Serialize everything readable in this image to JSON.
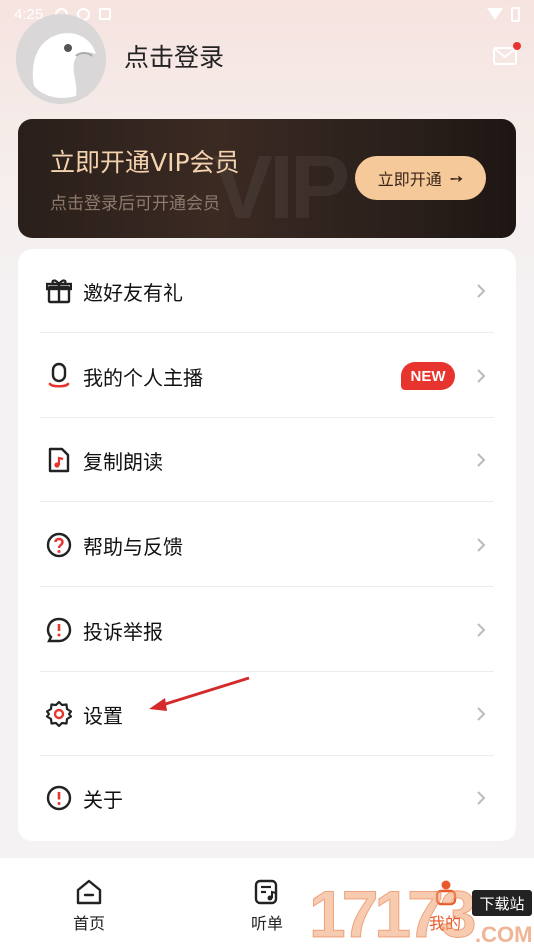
{
  "status_bar": {
    "time": "4:25"
  },
  "header": {
    "login_text": "点击登录"
  },
  "vip": {
    "title": "立即开通VIP会员",
    "subtitle": "点击登录后可开通会员",
    "button_label": "立即开通",
    "button_arrow": "➙",
    "watermark": "VIP"
  },
  "menu": {
    "items": [
      {
        "label": "邀好友有礼",
        "icon": "gift-icon"
      },
      {
        "label": "我的个人主播",
        "icon": "microphone-icon",
        "badge": "NEW"
      },
      {
        "label": "复制朗读",
        "icon": "music-document-icon"
      },
      {
        "label": "帮助与反馈",
        "icon": "help-icon"
      },
      {
        "label": "投诉举报",
        "icon": "report-icon"
      },
      {
        "label": "设置",
        "icon": "settings-icon"
      },
      {
        "label": "关于",
        "icon": "info-icon"
      }
    ]
  },
  "bottom_nav": {
    "items": [
      {
        "label": "首页",
        "icon": "home-icon"
      },
      {
        "label": "听单",
        "icon": "playlist-icon"
      },
      {
        "label": "我的",
        "icon": "profile-icon",
        "active": true
      }
    ]
  },
  "watermark": {
    "numbers": "17173",
    "site": "下载站",
    "com": ".COM"
  },
  "colors": {
    "accent": "#e85a2d",
    "vip_gold": "#f3d2ae",
    "vip_button": "#f6c99a",
    "badge_red": "#e8342f"
  }
}
